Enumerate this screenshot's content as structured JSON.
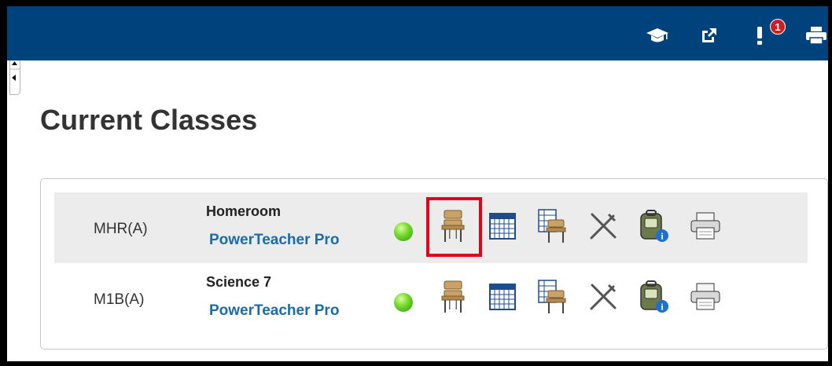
{
  "header": {
    "icons": [
      "graduation-cap-icon",
      "external-link-icon",
      "notifications-icon",
      "print-icon"
    ],
    "notification_count": "1"
  },
  "page_title": "Current Classes",
  "classes": [
    {
      "period": "MHR(A)",
      "course": "Homeroom",
      "gradebook_link": "PowerTeacher Pro",
      "status": "active",
      "seating_chart_highlighted": true
    },
    {
      "period": "M1B(A)",
      "course": "Science 7",
      "gradebook_link": "PowerTeacher Pro",
      "status": "active",
      "seating_chart_highlighted": false
    }
  ],
  "row_actions": [
    "seating-chart-icon",
    "calendar-icon",
    "roster-seating-icon",
    "tools-icon",
    "student-backpack-icon",
    "print-icon"
  ],
  "colors": {
    "header": "#00427c",
    "link": "#1a6baa",
    "highlight": "#e3001b",
    "status": "#4cc31b"
  }
}
